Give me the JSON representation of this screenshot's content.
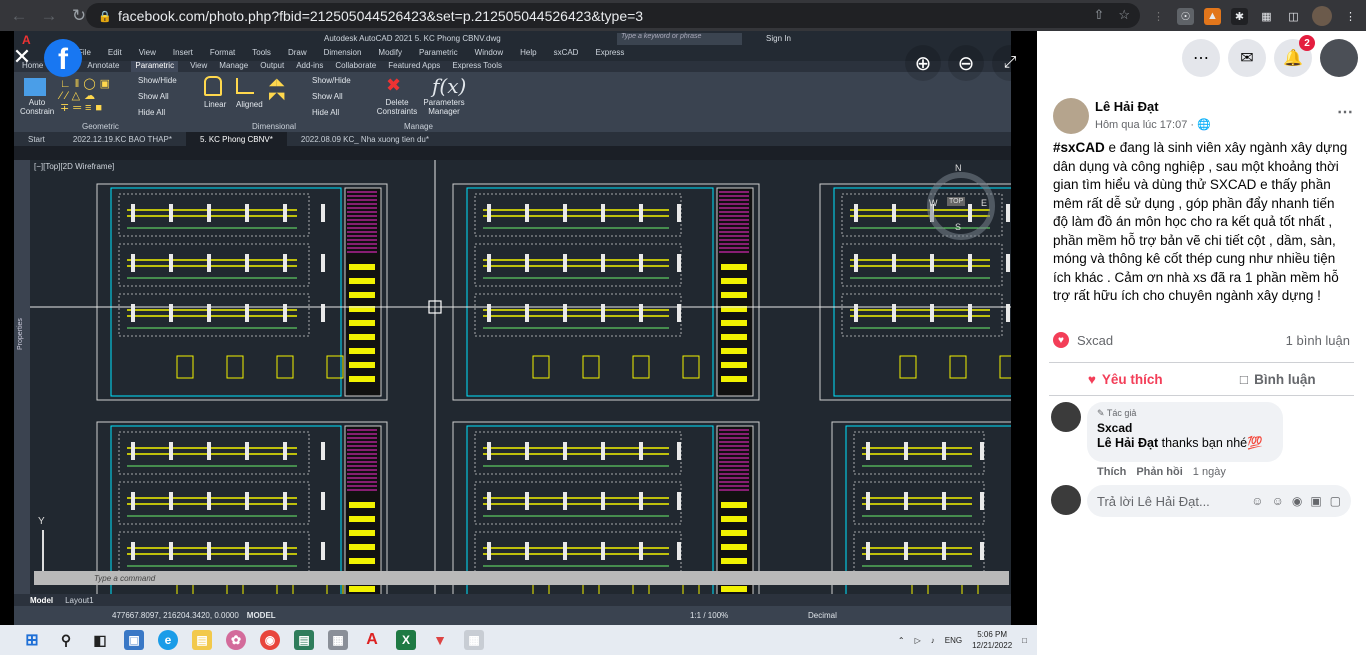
{
  "browser": {
    "url": "facebook.com/photo.php?fbid=212505044526423&set=p.212505044526423&type=3"
  },
  "photo": {
    "acad": {
      "title": "Autodesk AutoCAD 2021   5. KC Phong CBNV.dwg",
      "search_placeholder": "Type a keyword or phrase",
      "signin": "Sign In",
      "menu": [
        "File",
        "Edit",
        "View",
        "Insert",
        "Format",
        "Tools",
        "Draw",
        "Dimension",
        "Modify",
        "Parametric",
        "Window",
        "Help",
        "sxCAD",
        "Express"
      ],
      "ribbon_tabs": [
        "Home",
        "Insert",
        "Annotate",
        "Parametric",
        "View",
        "Manage",
        "Output",
        "Add-ins",
        "Collaborate",
        "Featured Apps",
        "Express Tools"
      ],
      "active_ribbon_tab": "Parametric",
      "ribbon": {
        "auto_constrain": "Auto Constrain",
        "geo_show_hide": "Show/Hide",
        "geo_show_all": "Show All",
        "geo_hide_all": "Hide All",
        "geometric": "Geometric",
        "linear": "Linear",
        "aligned": "Aligned",
        "dim_show_hide": "Show/Hide",
        "dim_show_all": "Show All",
        "dim_hide_all": "Hide All",
        "dimensional": "Dimensional",
        "delete_constraints": "Delete Constraints",
        "parameters_manager": "Parameters Manager",
        "manage": "Manage"
      },
      "doc_tabs": [
        "Start",
        "2022.12.19.KC BAO THAP*",
        "5. KC Phong CBNV*",
        "2022.08.09 KC_ Nha xuong tien du*"
      ],
      "active_doc_tab": "5. KC Phong CBNV*",
      "viewport_label": "[−][Top][2D Wireframe]",
      "palette_label": "Properties",
      "command_placeholder": "Type a command",
      "model_tabs": [
        "Model",
        "Layout1"
      ],
      "coords": "477667.8097, 216204.3420, 0.0000",
      "space": "MODEL",
      "scale": "1:1 / 100%",
      "units": "Decimal",
      "compass": {
        "n": "N",
        "s": "S",
        "e": "E",
        "w": "W",
        "top": "TOP"
      }
    }
  },
  "taskbar": {
    "lang": "ENG",
    "time": "5:06 PM",
    "date": "12/21/2022"
  },
  "post": {
    "author": "Lê Hải Đạt",
    "timestamp": "Hôm qua lúc 17:07",
    "hashtag": "#sxCAD",
    "text": " e đang là sinh viên xây ngành xây dựng dân dụng và công nghiệp , sau một khoảng thời gian tìm hiểu và dùng thử SXCAD e thấy phần mêm rất dễ sử dụng , góp phần đẩy nhanh tiến độ làm đồ án môn học cho ra kết quả tốt nhất , phần mềm hỗ trợ bản vẽ chi tiết cột , dầm, sàn, móng và thông kê cốt thép cung như nhiều tiện ích khác . Cảm ơn nhà xs đã ra 1 phần mềm hỗ trợ rất hữu ích cho chuyên ngành xây dựng !",
    "reactor": "Sxcad",
    "comment_count": "1 bình luận",
    "like_label": "Yêu thích",
    "comment_label": "Bình luận"
  },
  "comment": {
    "badge": "Tác giả",
    "author": "Sxcad",
    "mention": "Lê Hải Đạt",
    "text": " thanks bạn nhé💯",
    "like": "Thích",
    "reply": "Phản hồi",
    "time": "1 ngày"
  },
  "reply_box": {
    "placeholder": "Trả lời Lê Hải Đạt..."
  },
  "fb_header": {
    "notif_count": "2"
  },
  "colors": {
    "fb_blue": "#1877f2",
    "love_red": "#f33e58",
    "badge_red": "#e41e3f",
    "cad_yellow": "#f2f200",
    "cad_cyan": "#00e5ff",
    "cad_magenta": "#ff2ad4"
  }
}
